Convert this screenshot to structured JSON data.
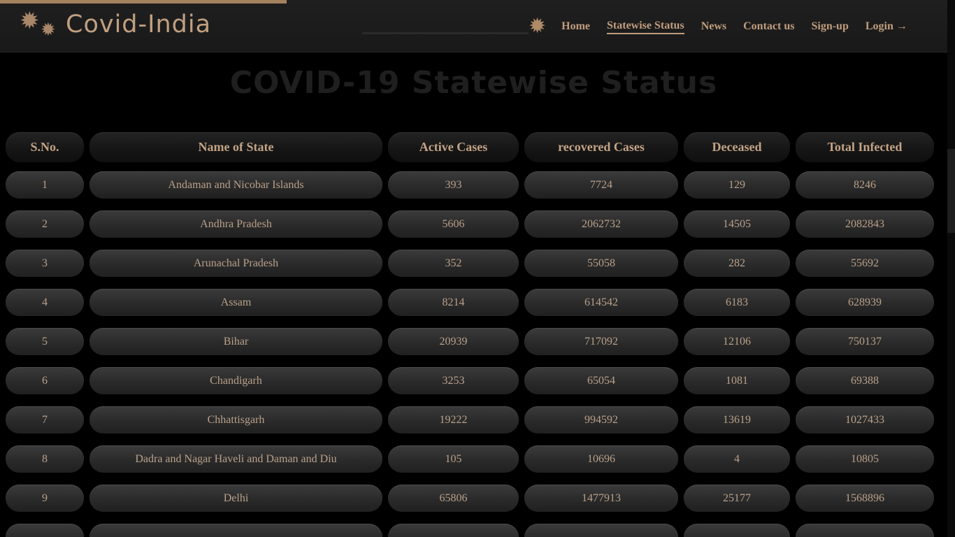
{
  "brand": {
    "name": "Covid-India",
    "icon": "gears-icon"
  },
  "nav": {
    "theme_icon": "sun-icon",
    "items": [
      {
        "label": "Home"
      },
      {
        "label": "Statewise Status",
        "active": true
      },
      {
        "label": "News"
      },
      {
        "label": "Contact us"
      },
      {
        "label": "Sign-up"
      },
      {
        "label": "Login",
        "icon": "arrow-right-icon"
      }
    ]
  },
  "page": {
    "title": "COVID-19 Statewise Status"
  },
  "table": {
    "headers": [
      "S.No.",
      "Name of State",
      "Active Cases",
      "recovered Cases",
      "Deceased",
      "Total Infected"
    ],
    "rows": [
      [
        "1",
        "Andaman and Nicobar Islands",
        "393",
        "7724",
        "129",
        "8246"
      ],
      [
        "2",
        "Andhra Pradesh",
        "5606",
        "2062732",
        "14505",
        "2082843"
      ],
      [
        "3",
        "Arunachal Pradesh",
        "352",
        "55058",
        "282",
        "55692"
      ],
      [
        "4",
        "Assam",
        "8214",
        "614542",
        "6183",
        "628939"
      ],
      [
        "5",
        "Bihar",
        "20939",
        "717092",
        "12106",
        "750137"
      ],
      [
        "6",
        "Chandigarh",
        "3253",
        "65054",
        "1081",
        "69388"
      ],
      [
        "7",
        "Chhattisgarh",
        "19222",
        "994592",
        "13619",
        "1027433"
      ],
      [
        "8",
        "Dadra and Nagar Haveli and Daman and Diu",
        "105",
        "10696",
        "4",
        "10805"
      ],
      [
        "9",
        "Delhi",
        "65806",
        "1477913",
        "25177",
        "1568896"
      ]
    ]
  },
  "colors": {
    "accent": "#c09d7e",
    "background": "#000000",
    "cell": "#2f2f2f"
  }
}
